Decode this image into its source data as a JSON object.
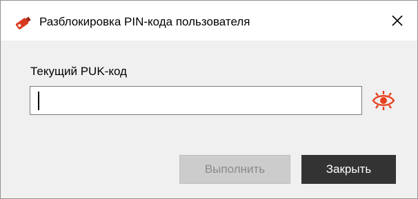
{
  "window": {
    "title": "Разблокировка PIN-кода пользователя",
    "close_glyph": "✕",
    "app_icon": "usb-token-icon",
    "close_icon": "close-icon"
  },
  "form": {
    "puk_label": "Текущий PUK-код",
    "puk_value": "",
    "show_password_icon": "eye-icon"
  },
  "buttons": {
    "execute_label": "Выполнить",
    "execute_enabled": false,
    "close_label": "Закрыть"
  },
  "colors": {
    "accent": "#e8401c",
    "icon_red": "#d9381e",
    "primary_button": "#333333",
    "disabled_button": "#cccccc"
  }
}
